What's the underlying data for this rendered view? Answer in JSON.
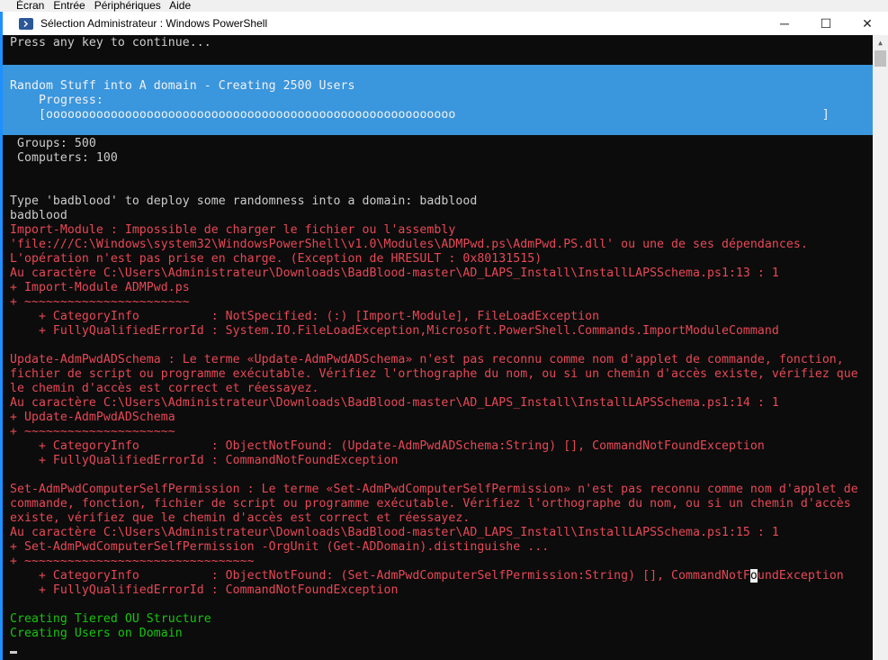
{
  "menubar": {
    "items": [
      "Écran",
      "Entrée",
      "Périphériques",
      "Aide"
    ]
  },
  "window": {
    "title": "Sélection Administrateur : Windows PowerShell",
    "minimize": "─",
    "maximize": "☐",
    "close": "✕"
  },
  "progress": {
    "title": "Random Stuff into A domain - Creating 2500 Users",
    "label": "Progress:",
    "bar": "[ooooooooooooooooooooooooooooooooooooooooooooooooooooooooo                                                   ]",
    "fraction": 0.53
  },
  "lines": [
    {
      "text": "Press any key to continue...",
      "c": "w"
    },
    {
      "text": " Groups: 500",
      "c": "w"
    },
    {
      "text": " Computers: 100",
      "c": "w"
    },
    {
      "text": "Type 'badblood' to deploy some randomness into a domain: badblood",
      "c": "w"
    },
    {
      "text": "badblood",
      "c": "w"
    },
    {
      "text": "Import-Module : Impossible de charger le fichier ou l'assembly",
      "c": "r"
    },
    {
      "text": "'file:///C:\\Windows\\system32\\WindowsPowerShell\\v1.0\\Modules\\ADMPwd.ps\\AdmPwd.PS.dll' ou une de ses dépendances.",
      "c": "r"
    },
    {
      "text": "L'opération n'est pas prise en charge. (Exception de HRESULT : 0x80131515)",
      "c": "r"
    },
    {
      "text": "Au caractère C:\\Users\\Administrateur\\Downloads\\BadBlood-master\\AD_LAPS_Install\\InstallLAPSSchema.ps1:13 : 1",
      "c": "r"
    },
    {
      "text": "+ Import-Module ADMPwd.ps",
      "c": "r"
    },
    {
      "text": "+ ~~~~~~~~~~~~~~~~~~~~~~~",
      "c": "r"
    },
    {
      "text": "    + CategoryInfo          : NotSpecified: (:) [Import-Module], FileLoadException",
      "c": "r"
    },
    {
      "text": "    + FullyQualifiedErrorId : System.IO.FileLoadException,Microsoft.PowerShell.Commands.ImportModuleCommand",
      "c": "r"
    },
    {
      "text": "Update-AdmPwdADSchema : Le terme «Update-AdmPwdADSchema» n'est pas reconnu comme nom d'applet de commande, fonction,",
      "c": "r"
    },
    {
      "text": "fichier de script ou programme exécutable. Vérifiez l'orthographe du nom, ou si un chemin d'accès existe, vérifiez que",
      "c": "r"
    },
    {
      "text": "le chemin d'accès est correct et réessayez.",
      "c": "r"
    },
    {
      "text": "Au caractère C:\\Users\\Administrateur\\Downloads\\BadBlood-master\\AD_LAPS_Install\\InstallLAPSSchema.ps1:14 : 1",
      "c": "r"
    },
    {
      "text": "+ Update-AdmPwdADSchema",
      "c": "r"
    },
    {
      "text": "+ ~~~~~~~~~~~~~~~~~~~~~",
      "c": "r"
    },
    {
      "text": "    + CategoryInfo          : ObjectNotFound: (Update-AdmPwdADSchema:String) [], CommandNotFoundException",
      "c": "r"
    },
    {
      "text": "    + FullyQualifiedErrorId : CommandNotFoundException",
      "c": "r"
    },
    {
      "text": "Set-AdmPwdComputerSelfPermission : Le terme «Set-AdmPwdComputerSelfPermission» n'est pas reconnu comme nom d'applet de",
      "c": "r"
    },
    {
      "text": "commande, fonction, fichier de script ou programme exécutable. Vérifiez l'orthographe du nom, ou si un chemin d'accès",
      "c": "r"
    },
    {
      "text": "existe, vérifiez que le chemin d'accès est correct et réessayez.",
      "c": "r"
    },
    {
      "text": "Au caractère C:\\Users\\Administrateur\\Downloads\\BadBlood-master\\AD_LAPS_Install\\InstallLAPSSchema.ps1:15 : 1",
      "c": "r"
    },
    {
      "text": "+ Set-AdmPwdComputerSelfPermission -OrgUnit (Get-ADDomain).distinguishe ...",
      "c": "r"
    },
    {
      "text": "+ ~~~~~~~~~~~~~~~~~~~~~~~~~~~~~~~~",
      "c": "r"
    },
    {
      "text": "    + CategoryInfo          : ObjectNotFound: (Set-AdmPwdComputerSelfPermission:String) [], CommandNotF",
      "c": "r",
      "sel": "o",
      "after": "undException"
    },
    {
      "text": "    + FullyQualifiedErrorId : CommandNotFoundException",
      "c": "r"
    },
    {
      "text": "Creating Tiered OU Structure",
      "c": "g"
    },
    {
      "text": "Creating Users on Domain",
      "c": "g"
    }
  ]
}
